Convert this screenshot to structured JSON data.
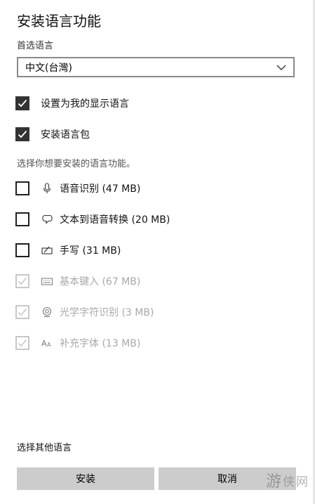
{
  "dialog": {
    "title": "安装语言功能",
    "preferred_label": "首选语言",
    "language_select": {
      "value": "中文(台灣)"
    },
    "options": [
      {
        "label": "设置为我的显示语言",
        "checked": true
      },
      {
        "label": "安装语言包",
        "checked": true
      }
    ],
    "features_hint": "选择你想要安装的语言功能。",
    "features": [
      {
        "label": "语音识别 (47 MB)",
        "icon": "microphone-icon",
        "checked": false,
        "disabled": false
      },
      {
        "label": "文本到语音转换 (20 MB)",
        "icon": "speech-bubble-icon",
        "checked": false,
        "disabled": false
      },
      {
        "label": "手写 (31 MB)",
        "icon": "pen-icon",
        "checked": false,
        "disabled": false
      },
      {
        "label": "基本键入 (67 MB)",
        "icon": "keyboard-icon",
        "checked": true,
        "disabled": true
      },
      {
        "label": "光学字符识别 (3 MB)",
        "icon": "camera-icon",
        "checked": true,
        "disabled": true
      },
      {
        "label": "补充字体 (13 MB)",
        "icon": "font-icon",
        "checked": true,
        "disabled": true
      }
    ],
    "other_languages_link": "选择其他语言",
    "install_button": "安装",
    "cancel_button": "取消"
  },
  "watermark": {
    "glyph": "游",
    "text": "侠网"
  },
  "colors": {
    "checked_fill": "#333333",
    "disabled_check": "#c8c8c8",
    "button_bg": "#cccccc",
    "dim_text": "#a8a8a8"
  }
}
